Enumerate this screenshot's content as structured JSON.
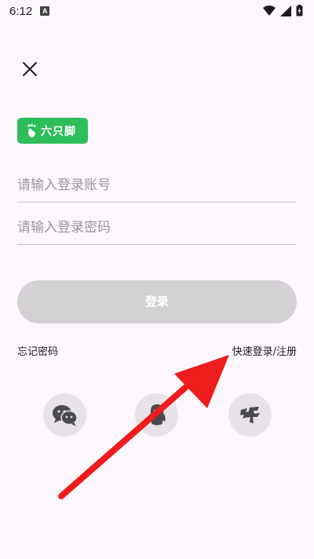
{
  "status_bar": {
    "time": "6:12",
    "notification_badge": "A"
  },
  "logo": {
    "text": "六只脚",
    "brand_color": "#2ebd5a"
  },
  "form": {
    "account_placeholder": "请输入登录账号",
    "password_placeholder": "请输入登录密码",
    "login_label": "登录"
  },
  "links": {
    "forgot_password": "忘记密码",
    "quick_login_register": "快速登录/注册"
  },
  "social_login": [
    {
      "icon": "wechat-icon"
    },
    {
      "icon": "qq-icon"
    },
    {
      "icon": "weibo-icon"
    }
  ],
  "annotation": {
    "arrow_color": "#ee1c1c",
    "points_to": "quick_login_register"
  }
}
